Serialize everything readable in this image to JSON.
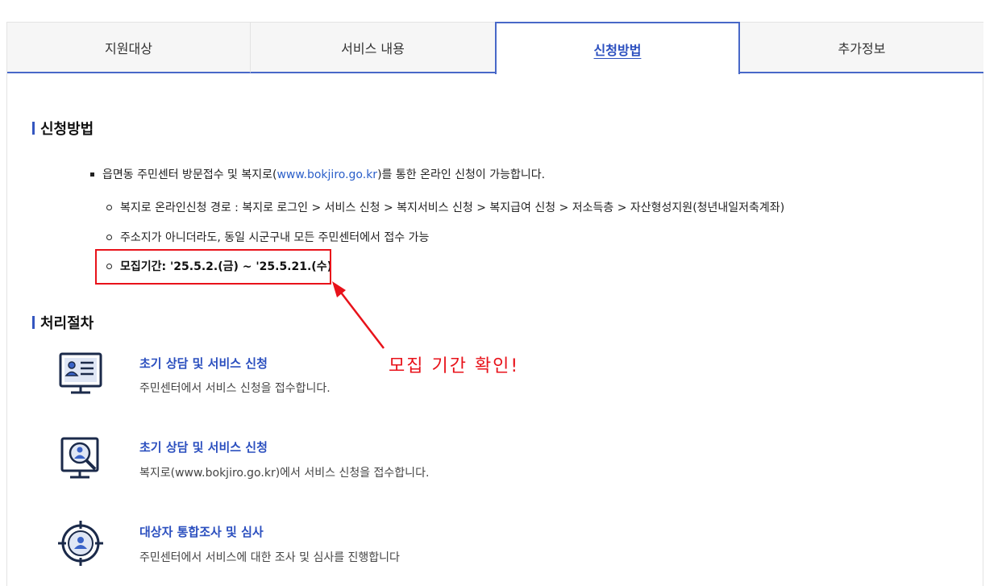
{
  "tabs": [
    {
      "label": "지원대상"
    },
    {
      "label": "서비스 내용"
    },
    {
      "label": "신청방법"
    },
    {
      "label": "추가정보"
    }
  ],
  "active_tab": "신청방법",
  "apply_section": {
    "title": "신청방법",
    "main_bullet_prefix": "읍면동 주민센터 방문접수 및 복지로(",
    "main_bullet_link": "www.bokjiro.go.kr",
    "main_bullet_suffix": ")를 통한 온라인 신청이 가능합니다.",
    "sub_items": [
      "복지로 온라인신청 경로 : 복지로 로그인 > 서비스 신청 > 복지서비스 신청 > 복지급여 신청 > 저소득층 > 자산형성지원(청년내일저축계좌)",
      "주소지가 아니더라도, 동일 시군구내 모든 주민센터에서 접수 가능",
      "모집기간: '25.5.2.(금) ~ '25.5.21.(수)"
    ]
  },
  "annotation": {
    "text": "모집 기간 확인!",
    "color": "#e8121a"
  },
  "process_section": {
    "title": "처리절차",
    "steps": [
      {
        "icon": "document-monitor-icon",
        "title": "초기 상담 및 서비스 신청",
        "desc": "주민센터에서 서비스 신청을 접수합니다."
      },
      {
        "icon": "search-person-monitor-icon",
        "title": "초기 상담 및 서비스 신청",
        "desc": "복지로(www.bokjiro.go.kr)에서 서비스 신청을 접수합니다."
      },
      {
        "icon": "target-person-icon",
        "title": "대상자 통합조사 및 심사",
        "desc": "주민센터에서 서비스에 대한 조사 및 심사를 진행합니다"
      }
    ]
  },
  "colors": {
    "accent": "#2b4fbf",
    "tab_border": "#4868c8",
    "highlight": "#e8121a"
  }
}
